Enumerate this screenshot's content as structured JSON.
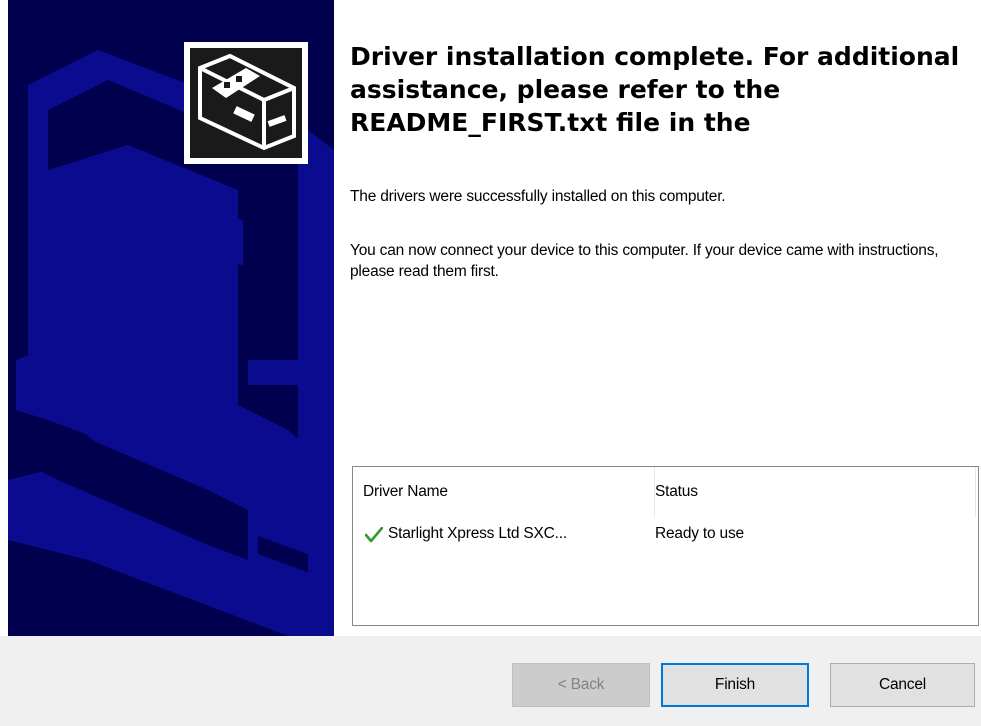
{
  "wizard": {
    "heading": "Driver installation complete. For additional assistance, please refer to the README_FIRST.txt file in the",
    "paragraphs": [
      "The drivers were successfully installed on this computer.",
      "You can now connect your device to this computer. If your device came with instructions, please read them first."
    ]
  },
  "driver_table": {
    "columns": [
      "Driver Name",
      "Status"
    ],
    "rows": [
      {
        "name": "Starlight Xpress Ltd SXC...",
        "status": "Ready to use",
        "icon": "check-icon"
      }
    ]
  },
  "buttons": {
    "back": "< Back",
    "finish": "Finish",
    "cancel": "Cancel"
  },
  "colors": {
    "side_panel": "#00004f",
    "art": "#0b0b8f",
    "check": "#2e9b2e",
    "focus_border": "#0078d7"
  }
}
